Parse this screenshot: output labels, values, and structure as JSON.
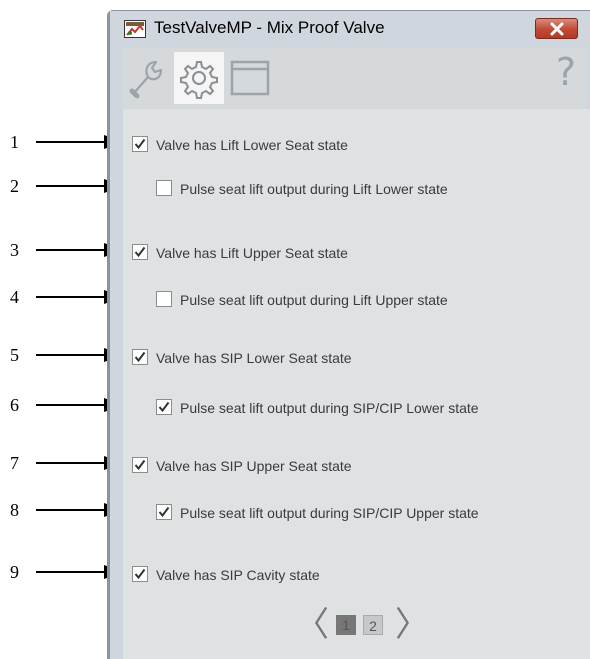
{
  "window": {
    "title": "TestValveMP - Mix Proof Valve",
    "tabs": [
      {
        "icon": "wrench-icon",
        "active": false
      },
      {
        "icon": "gear-icon",
        "active": true
      },
      {
        "icon": "window-icon",
        "active": false
      }
    ],
    "help_icon": "?"
  },
  "callouts": [
    "1",
    "2",
    "3",
    "4",
    "5",
    "6",
    "7",
    "8",
    "9"
  ],
  "options": [
    {
      "label": "Valve has Lift Lower Seat state",
      "checked": true
    },
    {
      "label": "Pulse seat lift output during Lift Lower state",
      "checked": false
    },
    {
      "label": "Valve has Lift Upper Seat state",
      "checked": true
    },
    {
      "label": "Pulse seat lift output during Lift Upper state",
      "checked": false
    },
    {
      "label": "Valve has SIP Lower Seat state",
      "checked": true
    },
    {
      "label": "Pulse seat lift output during SIP/CIP Lower state",
      "checked": true
    },
    {
      "label": "Valve has SIP Upper Seat state",
      "checked": true
    },
    {
      "label": "Pulse seat lift output during SIP/CIP Upper state",
      "checked": true
    },
    {
      "label": "Valve has SIP Cavity state",
      "checked": true
    }
  ],
  "pager": {
    "prev": "〈",
    "next": "〉",
    "pages": [
      "1",
      "2"
    ],
    "current_page": 1
  },
  "colors": {
    "window_bg": "#cfd6de",
    "content_bg": "#dfe2e3",
    "close_button": "#c14a35"
  }
}
